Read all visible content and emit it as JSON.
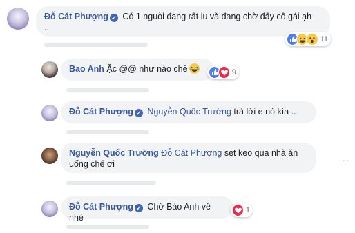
{
  "comments": [
    {
      "author": "Đỗ Cát Phượng",
      "verified_icon": "verified-badge-icon",
      "text_line1": "Có 1 nguòi đang rất iu và đang chờ đấy cô gái ạh",
      "text_line2": "..",
      "reactions": [
        "like",
        "haha",
        "wow"
      ],
      "reaction_count": "11"
    },
    {
      "author": "Bao Anh",
      "text": "Ặc @@ như nào chế",
      "emoji": "laughing-tears-emoji",
      "reactions": [
        "like",
        "love"
      ],
      "reaction_count": "9"
    },
    {
      "author": "Đỗ Cát Phượng",
      "verified_icon": "verified-badge-icon",
      "tagged": "Nguyễn Quốc Trường",
      "text": "trả lời e nó kìa .."
    },
    {
      "author": "Nguyễn Quốc Trường",
      "tagged": "Đỗ Cát Phượng",
      "text_line1": "set keo qua nhà ăn",
      "text_line2": "uống chế ơi"
    },
    {
      "author": "Đỗ Cát Phượng",
      "verified_icon": "verified-badge-icon",
      "text": "Chờ Bảo Anh về nhé",
      "reactions": [
        "love"
      ],
      "reaction_count": "1"
    }
  ],
  "colors": {
    "name": "#385898",
    "bubble": "#f2f3f5",
    "like": "#4a7ff2",
    "love": "#f0284a",
    "haha": "#f7c948"
  }
}
